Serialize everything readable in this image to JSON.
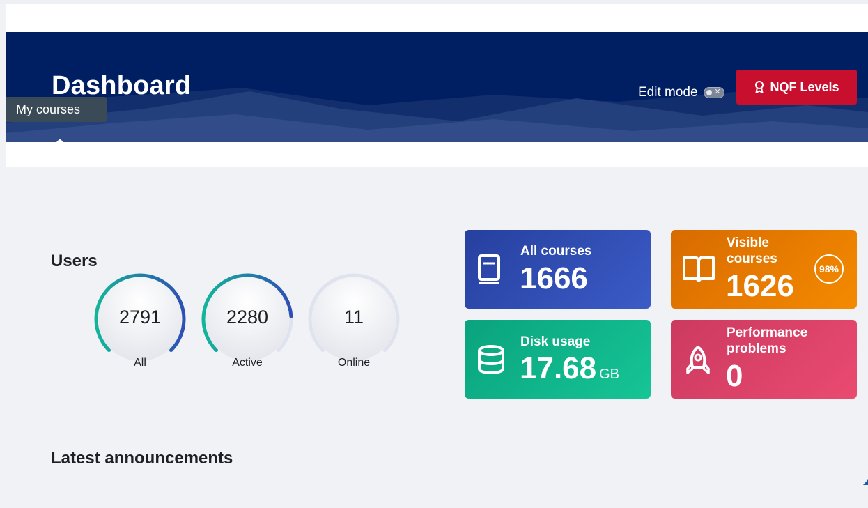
{
  "header": {
    "title": "Dashboard",
    "edit_mode_label": "Edit mode",
    "nqf_button_label": "NQF Levels"
  },
  "tooltip": {
    "text": "My courses"
  },
  "users": {
    "title": "Users",
    "gauges": [
      {
        "value": "2791",
        "label": "All",
        "fill_fraction": 1.0
      },
      {
        "value": "2280",
        "label": "Active",
        "fill_fraction": 0.82
      },
      {
        "value": "11",
        "label": "Online",
        "fill_fraction": 0.004
      }
    ]
  },
  "stats": {
    "all_courses": {
      "label": "All courses",
      "value": "1666",
      "icon": "book-icon",
      "color": "#2f4fb5"
    },
    "visible_courses": {
      "label": "Visible courses",
      "value": "1626",
      "badge": "98%",
      "icon": "open-book-icon",
      "color": "#e97a00"
    },
    "disk_usage": {
      "label": "Disk usage",
      "value": "17.68",
      "unit": "GB",
      "icon": "database-icon",
      "color": "#0fb58b"
    },
    "performance": {
      "label": "Performance problems",
      "value": "0",
      "icon": "rocket-icon",
      "color": "#e0466a"
    }
  },
  "announcements": {
    "title": "Latest announcements"
  },
  "colors": {
    "hero_bg": "#001e62",
    "accent_red": "#c8102e",
    "gauge_gradient_start": "#13b59a",
    "gauge_gradient_end": "#2e4fb3",
    "page_bg": "#f0f2f5"
  }
}
